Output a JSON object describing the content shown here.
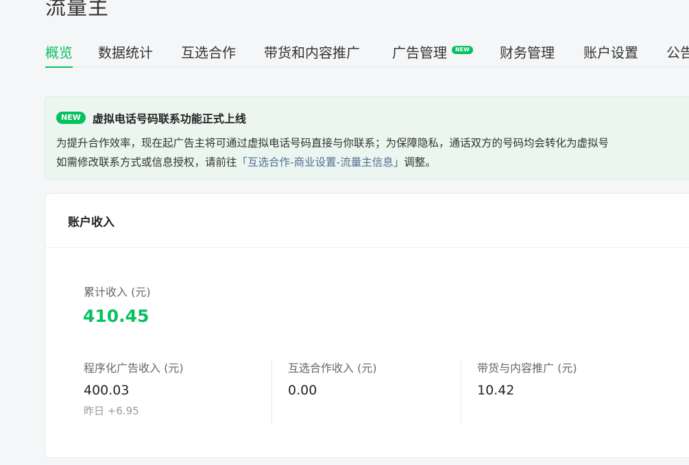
{
  "header": {
    "title": "流量主"
  },
  "nav": {
    "tabs": [
      {
        "label": "概览",
        "active": true
      },
      {
        "label": "数据统计"
      },
      {
        "label": "互选合作"
      },
      {
        "label": "带货和内容推广"
      },
      {
        "label": "广告管理",
        "badge": "NEW"
      },
      {
        "label": "财务管理"
      },
      {
        "label": "账户设置"
      },
      {
        "label": "公告"
      }
    ]
  },
  "notice": {
    "badge": "NEW",
    "title": "虚拟电话号码联系功能正式上线",
    "line1": "为提升合作效率，现在起广告主将可通过虚拟电话号码直接与你联系；为保障隐私，通话双方的号码均会转化为虚拟号",
    "line2_prefix": "如需修改联系方式或信息授权，请前往",
    "line2_link": "「互选合作-商业设置-流量主信息」",
    "line2_suffix": "调整。"
  },
  "income": {
    "title": "账户收入",
    "total_label": "累计收入 (元)",
    "total_value": "410.45",
    "metrics": [
      {
        "label": "程序化广告收入 (元)",
        "value": "400.03",
        "sub": "昨日 +6.95"
      },
      {
        "label": "互选合作收入 (元)",
        "value": "0.00"
      },
      {
        "label": "带货与内容推广 (元)",
        "value": "10.42"
      }
    ]
  },
  "colors": {
    "accent": "#07c160",
    "link": "#576b95",
    "notice_bg": "#eaf6ef"
  }
}
